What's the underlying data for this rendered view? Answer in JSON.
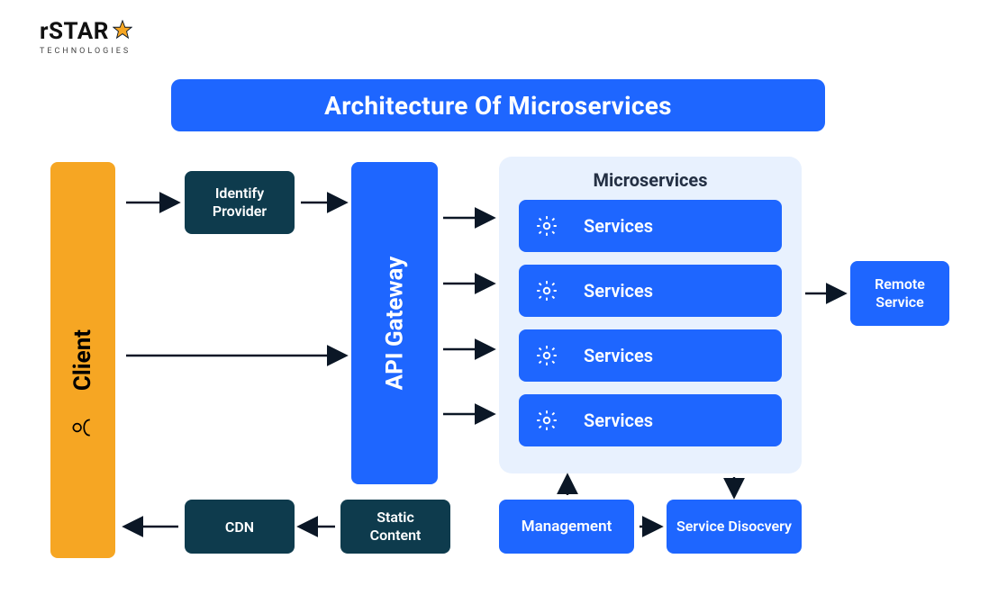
{
  "brand": {
    "name": "rSTAR",
    "subtitle": "TECHNOLOGIES"
  },
  "title": "Architecture Of Microservices",
  "client": {
    "label": "Client"
  },
  "api_gateway": {
    "label": "API Gateway"
  },
  "identify": {
    "label": "Identify Provider"
  },
  "cdn": {
    "label": "CDN"
  },
  "static_content": {
    "label": "Static Content"
  },
  "management": {
    "label": "Management"
  },
  "discovery": {
    "label": "Service Disocvery"
  },
  "remote": {
    "label": "Remote Service"
  },
  "microservices": {
    "title": "Microservices",
    "items": [
      {
        "label": "Services"
      },
      {
        "label": "Services"
      },
      {
        "label": "Services"
      },
      {
        "label": "Services"
      }
    ]
  },
  "colors": {
    "blue": "#1e66ff",
    "teal_dark": "#0e3b4d",
    "orange": "#f6a623",
    "pale": "#e8f1fe"
  }
}
